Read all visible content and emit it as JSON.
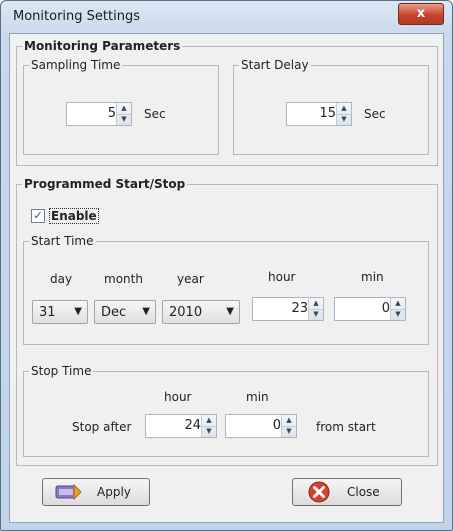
{
  "window": {
    "title": "Monitoring Settings",
    "close_glyph": "x"
  },
  "monitoring": {
    "title": "Monitoring Parameters",
    "sampling": {
      "legend": "Sampling Time",
      "value": "5",
      "unit": "Sec"
    },
    "delay": {
      "legend": "Start Delay",
      "value": "15",
      "unit": "Sec"
    }
  },
  "programmed": {
    "title": "Programmed Start/Stop",
    "enable": {
      "label": "Enable",
      "checked": true
    },
    "start": {
      "legend": "Start Time",
      "headers": {
        "day": "day",
        "month": "month",
        "year": "year",
        "hour": "hour",
        "min": "min"
      },
      "day": "31",
      "month": "Dec",
      "year": "2010",
      "hour": "23",
      "min": "0"
    },
    "stop": {
      "legend": "Stop Time",
      "headers": {
        "hour": "hour",
        "min": "min"
      },
      "prefix": "Stop after",
      "hour": "24",
      "min": "0",
      "suffix": "from start"
    }
  },
  "buttons": {
    "apply": "Apply",
    "close": "Close"
  },
  "icons": {
    "up": "▲",
    "down": "▼",
    "dropdown": "▼",
    "check": "✓"
  }
}
